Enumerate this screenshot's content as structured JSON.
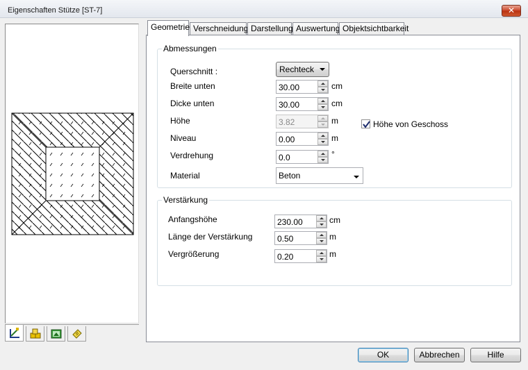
{
  "window": {
    "title": "Eigenschaften Stütze [ST-7]",
    "close_glyph": "✕"
  },
  "tabs": [
    {
      "label": "Geometrie",
      "active": true
    },
    {
      "label": "Verschneidung"
    },
    {
      "label": "Darstellung"
    },
    {
      "label": "Auswertung"
    },
    {
      "label": "Objektsichtbarkeit"
    }
  ],
  "left_tabs": [
    "geometry-icon",
    "objects-icon",
    "image-icon",
    "notes-icon"
  ],
  "abmessungen": {
    "title": "Abmessungen",
    "querschnitt": {
      "label": "Querschnitt :",
      "value": "Rechteck"
    },
    "breite": {
      "label": "Breite unten",
      "value": "30.00",
      "unit": "cm"
    },
    "dicke": {
      "label": "Dicke unten",
      "value": "30.00",
      "unit": "cm"
    },
    "hoehe": {
      "label": "Höhe",
      "value": "3.82",
      "unit": "m"
    },
    "hoehe_von_geschoss": {
      "label": "Höhe von Geschoss",
      "checked": true
    },
    "niveau": {
      "label": "Niveau",
      "value": "0.00",
      "unit": "m"
    },
    "verdrehung": {
      "label": "Verdrehung",
      "value": "0.0",
      "unit": "°"
    },
    "material": {
      "label": "Material",
      "value": "Beton"
    }
  },
  "verstaerkung": {
    "title": "Verstärkung",
    "anfangshoehe": {
      "label": "Anfangshöhe",
      "value": "230.00",
      "unit": "cm"
    },
    "laenge": {
      "label": "Länge der Verstärkung",
      "value": "0.50",
      "unit": "m"
    },
    "vergroesserung": {
      "label": "Vergrößerung",
      "value": "0.20",
      "unit": "m"
    }
  },
  "buttons": {
    "ok": "OK",
    "cancel": "Abbrechen",
    "help": "Hilfe"
  },
  "colors": {
    "accent_border": "#3c7fb1",
    "close_red": "#c94427"
  }
}
